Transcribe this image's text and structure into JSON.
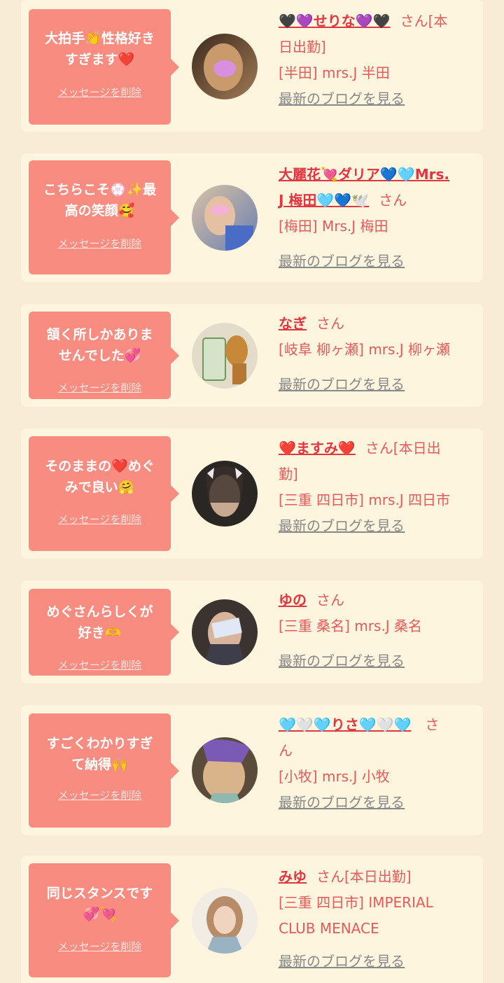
{
  "messages": [
    {
      "comment_lines": [
        "大拍手👏性格好き",
        "すぎます❤️"
      ],
      "delete_label": "メッセージを削除",
      "name": "🖤💜せりな💜🖤",
      "san": "さん[本",
      "san2": "日出勤]",
      "shop": "[半田] mrs.J 半田",
      "blog": "最新のブログを見る"
    },
    {
      "comment_lines": [
        "こちらこそ💮✨最",
        "高の笑顔🥰"
      ],
      "delete_label": "メッセージを削除",
      "name": "大麗花💘ダリア💙🩵Mrs.",
      "name2": "J 梅田🩵💙🕊️",
      "san": "さん",
      "shop": "[梅田] Mrs.J 梅田",
      "blog": "最新のブログを見る"
    },
    {
      "comment_lines": [
        "頷く所しかありま",
        "せんでした💞"
      ],
      "delete_label": "メッセージを削除",
      "name": "なぎ",
      "san": "さん",
      "shop": "[岐阜 柳ヶ瀬] mrs.J 柳ヶ瀬",
      "blog": "最新のブログを見る"
    },
    {
      "comment_lines": [
        "そのままの❤️めぐ",
        "みで良い🤗"
      ],
      "delete_label": "メッセージを削除",
      "name": "❤️ますみ❤️",
      "san": "さん[本日出",
      "san2": "勤]",
      "shop": "[三重 四日市] mrs.J 四日市",
      "blog": "最新のブログを見る"
    },
    {
      "comment_lines": [
        "めぐさんらしくが",
        "好き🫶"
      ],
      "delete_label": "メッセージを削除",
      "name": "ゆの",
      "san": "さん",
      "shop": "[三重 桑名] mrs.J 桑名",
      "blog": "最新のブログを見る"
    },
    {
      "comment_lines": [
        "すごくわかりすぎ",
        "て納得🙌"
      ],
      "delete_label": "メッセージを削除",
      "name": "🩵🤍🩵りさ🩵🤍🩵",
      "san": "さ",
      "san2": "ん",
      "shop": "[小牧] mrs.J 小牧",
      "blog": "最新のブログを見る"
    },
    {
      "comment_lines": [
        "同じスタンスです",
        "💞💘"
      ],
      "delete_label": "メッセージを削除",
      "name": "みゆ",
      "san": "さん[本日出勤]",
      "shop": "[三重 四日市] IMPERIAL",
      "shop2": "CLUB MENACE",
      "blog": "最新のブログを見る"
    }
  ],
  "colors": {
    "page_bg": "#f9ecd6",
    "card_bg": "#fef5df",
    "bubble_bg": "#f98c80",
    "name_color": "#e3353f",
    "info_color": "#e8595a",
    "link_color": "#888888"
  }
}
